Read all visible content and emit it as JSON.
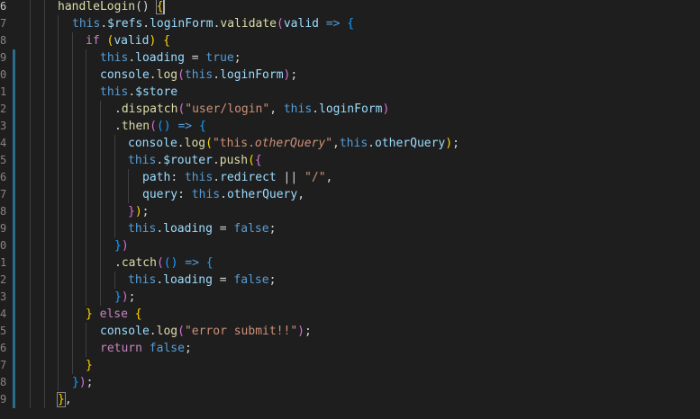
{
  "editor": {
    "line_numbers": [
      "6",
      "7",
      "8",
      "9",
      "0",
      "1",
      "2",
      "3",
      "4",
      "5",
      "6",
      "7",
      "8",
      "9",
      "0",
      "1",
      "2",
      "3",
      "4",
      "5",
      "6",
      "7",
      "8",
      "9"
    ],
    "active_line_index": 0,
    "lines": [
      [
        {
          "t": "handleLogin",
          "c": "fn"
        },
        {
          "t": "() ",
          "c": "punc"
        },
        {
          "t": "{",
          "c": "b1",
          "m": true
        }
      ],
      [
        {
          "t": "this",
          "c": "kw"
        },
        {
          "t": ".",
          "c": "punc"
        },
        {
          "t": "$refs",
          "c": "prop"
        },
        {
          "t": ".",
          "c": "punc"
        },
        {
          "t": "loginForm",
          "c": "prop"
        },
        {
          "t": ".",
          "c": "punc"
        },
        {
          "t": "validate",
          "c": "fn"
        },
        {
          "t": "(",
          "c": "b2"
        },
        {
          "t": "valid",
          "c": "var"
        },
        {
          "t": " ",
          "c": "punc"
        },
        {
          "t": "=>",
          "c": "arrow"
        },
        {
          "t": " ",
          "c": "punc"
        },
        {
          "t": "{",
          "c": "b3"
        }
      ],
      [
        {
          "t": "if",
          "c": "ctrl"
        },
        {
          "t": " ",
          "c": "punc"
        },
        {
          "t": "(",
          "c": "b1"
        },
        {
          "t": "valid",
          "c": "var"
        },
        {
          "t": ")",
          "c": "b1"
        },
        {
          "t": " ",
          "c": "punc"
        },
        {
          "t": "{",
          "c": "b1"
        }
      ],
      [
        {
          "t": "this",
          "c": "kw"
        },
        {
          "t": ".",
          "c": "punc"
        },
        {
          "t": "loading",
          "c": "prop"
        },
        {
          "t": " = ",
          "c": "punc"
        },
        {
          "t": "true",
          "c": "kw"
        },
        {
          "t": ";",
          "c": "punc"
        }
      ],
      [
        {
          "t": "console",
          "c": "var"
        },
        {
          "t": ".",
          "c": "punc"
        },
        {
          "t": "log",
          "c": "fn"
        },
        {
          "t": "(",
          "c": "b2"
        },
        {
          "t": "this",
          "c": "kw"
        },
        {
          "t": ".",
          "c": "punc"
        },
        {
          "t": "loginForm",
          "c": "prop"
        },
        {
          "t": ")",
          "c": "b2"
        },
        {
          "t": ";",
          "c": "punc"
        }
      ],
      [
        {
          "t": "this",
          "c": "kw"
        },
        {
          "t": ".",
          "c": "punc"
        },
        {
          "t": "$store",
          "c": "prop"
        }
      ],
      [
        {
          "t": ".",
          "c": "punc"
        },
        {
          "t": "dispatch",
          "c": "fn"
        },
        {
          "t": "(",
          "c": "b2"
        },
        {
          "t": "\"user/login\"",
          "c": "str"
        },
        {
          "t": ", ",
          "c": "punc"
        },
        {
          "t": "this",
          "c": "kw"
        },
        {
          "t": ".",
          "c": "punc"
        },
        {
          "t": "loginForm",
          "c": "prop"
        },
        {
          "t": ")",
          "c": "b2"
        }
      ],
      [
        {
          "t": ".",
          "c": "punc"
        },
        {
          "t": "then",
          "c": "fn"
        },
        {
          "t": "(",
          "c": "b2"
        },
        {
          "t": "()",
          "c": "b3"
        },
        {
          "t": " ",
          "c": "punc"
        },
        {
          "t": "=>",
          "c": "arrow"
        },
        {
          "t": " ",
          "c": "punc"
        },
        {
          "t": "{",
          "c": "b3"
        }
      ],
      [
        {
          "t": "console",
          "c": "var"
        },
        {
          "t": ".",
          "c": "punc"
        },
        {
          "t": "log",
          "c": "fn"
        },
        {
          "t": "(",
          "c": "b1"
        },
        {
          "t": "\"this.",
          "c": "str"
        },
        {
          "t": "otherQuery",
          "c": "str",
          "i": true
        },
        {
          "t": "\"",
          "c": "str"
        },
        {
          "t": ",",
          "c": "punc"
        },
        {
          "t": "this",
          "c": "kw"
        },
        {
          "t": ".",
          "c": "punc"
        },
        {
          "t": "otherQuery",
          "c": "prop"
        },
        {
          "t": ")",
          "c": "b1"
        },
        {
          "t": ";",
          "c": "punc"
        }
      ],
      [
        {
          "t": "this",
          "c": "kw"
        },
        {
          "t": ".",
          "c": "punc"
        },
        {
          "t": "$router",
          "c": "prop"
        },
        {
          "t": ".",
          "c": "punc"
        },
        {
          "t": "push",
          "c": "fn"
        },
        {
          "t": "(",
          "c": "b1"
        },
        {
          "t": "{",
          "c": "b2"
        }
      ],
      [
        {
          "t": "path",
          "c": "prop"
        },
        {
          "t": ": ",
          "c": "punc"
        },
        {
          "t": "this",
          "c": "kw"
        },
        {
          "t": ".",
          "c": "punc"
        },
        {
          "t": "redirect",
          "c": "prop"
        },
        {
          "t": " || ",
          "c": "punc"
        },
        {
          "t": "\"/\"",
          "c": "str"
        },
        {
          "t": ",",
          "c": "punc"
        }
      ],
      [
        {
          "t": "query",
          "c": "prop"
        },
        {
          "t": ": ",
          "c": "punc"
        },
        {
          "t": "this",
          "c": "kw"
        },
        {
          "t": ".",
          "c": "punc"
        },
        {
          "t": "otherQuery",
          "c": "prop"
        },
        {
          "t": ",",
          "c": "punc"
        }
      ],
      [
        {
          "t": "}",
          "c": "b2"
        },
        {
          "t": ")",
          "c": "b1"
        },
        {
          "t": ";",
          "c": "punc"
        }
      ],
      [
        {
          "t": "this",
          "c": "kw"
        },
        {
          "t": ".",
          "c": "punc"
        },
        {
          "t": "loading",
          "c": "prop"
        },
        {
          "t": " = ",
          "c": "punc"
        },
        {
          "t": "false",
          "c": "kw"
        },
        {
          "t": ";",
          "c": "punc"
        }
      ],
      [
        {
          "t": "}",
          "c": "b3"
        },
        {
          "t": ")",
          "c": "b2"
        }
      ],
      [
        {
          "t": ".",
          "c": "punc"
        },
        {
          "t": "catch",
          "c": "fn"
        },
        {
          "t": "(",
          "c": "b2"
        },
        {
          "t": "()",
          "c": "b3"
        },
        {
          "t": " ",
          "c": "punc"
        },
        {
          "t": "=>",
          "c": "arrow"
        },
        {
          "t": " ",
          "c": "punc"
        },
        {
          "t": "{",
          "c": "b3"
        }
      ],
      [
        {
          "t": "this",
          "c": "kw"
        },
        {
          "t": ".",
          "c": "punc"
        },
        {
          "t": "loading",
          "c": "prop"
        },
        {
          "t": " = ",
          "c": "punc"
        },
        {
          "t": "false",
          "c": "kw"
        },
        {
          "t": ";",
          "c": "punc"
        }
      ],
      [
        {
          "t": "}",
          "c": "b3"
        },
        {
          "t": ")",
          "c": "b2"
        },
        {
          "t": ";",
          "c": "punc"
        }
      ],
      [
        {
          "t": "}",
          "c": "b1"
        },
        {
          "t": " ",
          "c": "punc"
        },
        {
          "t": "else",
          "c": "ctrl"
        },
        {
          "t": " ",
          "c": "punc"
        },
        {
          "t": "{",
          "c": "b1"
        }
      ],
      [
        {
          "t": "console",
          "c": "var"
        },
        {
          "t": ".",
          "c": "punc"
        },
        {
          "t": "log",
          "c": "fn"
        },
        {
          "t": "(",
          "c": "b2"
        },
        {
          "t": "\"error submit!!\"",
          "c": "str"
        },
        {
          "t": ")",
          "c": "b2"
        },
        {
          "t": ";",
          "c": "punc"
        }
      ],
      [
        {
          "t": "return",
          "c": "ctrl"
        },
        {
          "t": " ",
          "c": "punc"
        },
        {
          "t": "false",
          "c": "kw"
        },
        {
          "t": ";",
          "c": "punc"
        }
      ],
      [
        {
          "t": "}",
          "c": "b1"
        }
      ],
      [
        {
          "t": "}",
          "c": "b3"
        },
        {
          "t": ")",
          "c": "b2"
        },
        {
          "t": ";",
          "c": "punc"
        }
      ],
      [
        {
          "t": "}",
          "c": "b1",
          "m": true
        },
        {
          "t": ",",
          "c": "punc"
        }
      ]
    ],
    "indent_levels": [
      2,
      3,
      4,
      5,
      5,
      5,
      6,
      6,
      7,
      7,
      8,
      8,
      7,
      7,
      6,
      6,
      7,
      6,
      4,
      5,
      5,
      4,
      3,
      2
    ],
    "modified_lines": [
      3,
      4,
      5,
      6,
      7,
      8,
      9,
      10,
      11,
      12,
      13,
      14,
      15,
      16,
      17,
      18,
      19,
      20,
      21,
      22,
      23
    ]
  }
}
